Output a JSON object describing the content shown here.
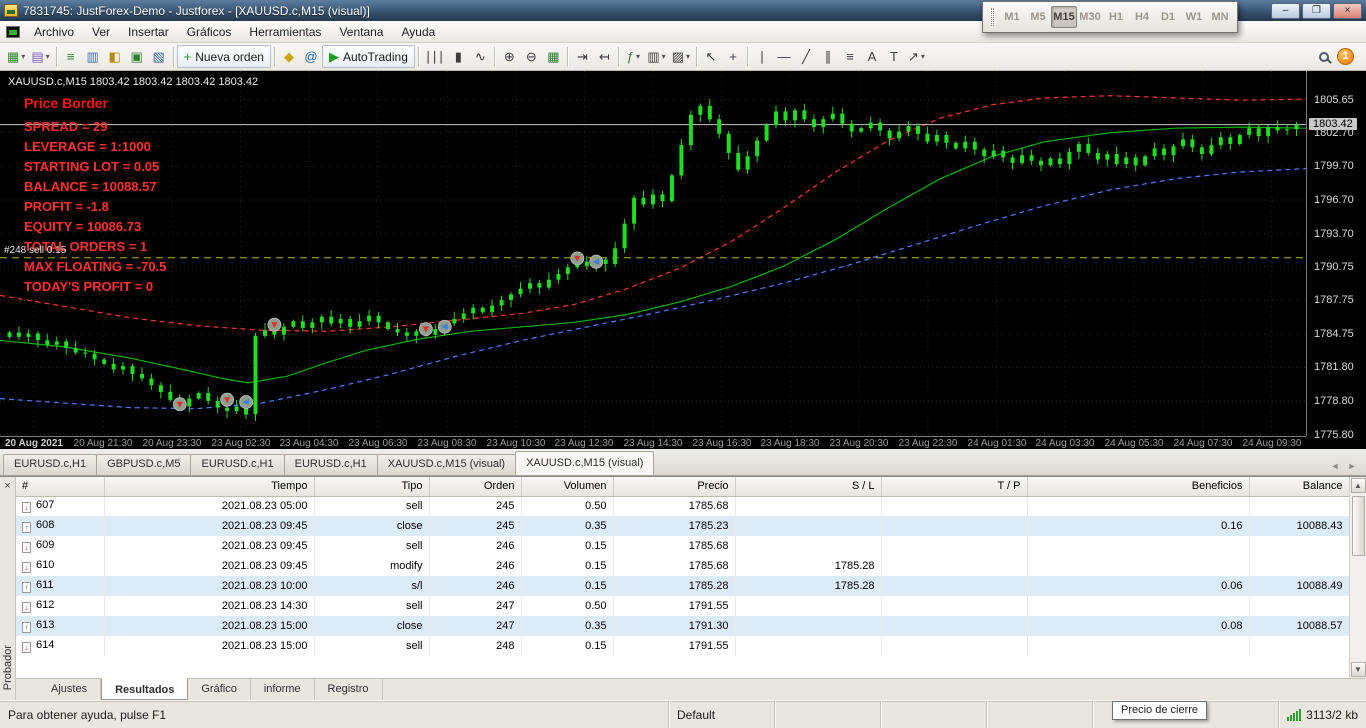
{
  "titlebar": {
    "title": "7831745: JustForex-Demo - Justforex - [XAUUSD.c,M15 (visual)]",
    "minimize": "–",
    "restore": "❐",
    "close": "×"
  },
  "menubar": {
    "items": [
      "Archivo",
      "Ver",
      "Insertar",
      "Gráficos",
      "Herramientas",
      "Ventana",
      "Ayuda"
    ]
  },
  "toolbar": {
    "buttons": [
      {
        "name": "new-chart",
        "glyph": "▦",
        "color": "#2e8b2e",
        "dropdown": true
      },
      {
        "name": "profiles",
        "glyph": "▤",
        "color": "#7a5fc0",
        "dropdown": true
      },
      {
        "type": "sep"
      },
      {
        "name": "market-watch",
        "glyph": "≡",
        "color": "#2e7d32"
      },
      {
        "name": "data-window",
        "glyph": "▥",
        "color": "#4a6fa5"
      },
      {
        "name": "navigator",
        "glyph": "◧",
        "color": "#b8860b"
      },
      {
        "name": "terminal",
        "glyph": "▣",
        "color": "#2e7d32"
      },
      {
        "name": "strategy-tester",
        "glyph": "▧",
        "color": "#4a6fa5"
      },
      {
        "type": "sep"
      },
      {
        "name": "new-order",
        "glyph": "+",
        "color": "#18a018",
        "label": "Nueva orden"
      },
      {
        "type": "sep"
      },
      {
        "name": "metaeditor",
        "glyph": "◆",
        "color": "#c9a313"
      },
      {
        "name": "mql-community",
        "glyph": "@",
        "color": "#1565c0"
      },
      {
        "name": "autotrading",
        "glyph": "▶",
        "color": "#18a018",
        "label": "AutoTrading"
      },
      {
        "type": "sep"
      },
      {
        "name": "chart-bars",
        "glyph": "∣∣∣",
        "color": "#3c3c3c"
      },
      {
        "name": "chart-candles",
        "glyph": "▮",
        "color": "#3c3c3c"
      },
      {
        "name": "chart-line",
        "glyph": "∿",
        "color": "#3c3c3c"
      },
      {
        "type": "sep"
      },
      {
        "name": "zoom-in",
        "glyph": "⊕",
        "color": "#3c3c3c"
      },
      {
        "name": "zoom-out",
        "glyph": "⊖",
        "color": "#3c3c3c"
      },
      {
        "name": "tile-windows",
        "glyph": "▦",
        "color": "#2e7d32"
      },
      {
        "type": "sep"
      },
      {
        "name": "auto-scroll",
        "glyph": "⇥",
        "color": "#3c3c3c"
      },
      {
        "name": "chart-shift",
        "glyph": "↤",
        "color": "#3c3c3c"
      },
      {
        "type": "sep"
      },
      {
        "name": "indicators",
        "glyph": "ƒ",
        "color": "#2e7d32",
        "dropdown": true
      },
      {
        "name": "periods",
        "glyph": "▥",
        "color": "#3c3c3c",
        "dropdown": true
      },
      {
        "name": "templates",
        "glyph": "▨",
        "color": "#3c3c3c",
        "dropdown": true
      },
      {
        "type": "sep"
      },
      {
        "name": "cursor",
        "glyph": "↖",
        "color": "#3c3c3c"
      },
      {
        "name": "crosshair",
        "glyph": "+",
        "color": "#3c3c3c"
      },
      {
        "type": "sep"
      },
      {
        "name": "vertical-line",
        "glyph": "∣",
        "color": "#3c3c3c"
      },
      {
        "name": "horizontal-line",
        "glyph": "―",
        "color": "#3c3c3c"
      },
      {
        "name": "trendline",
        "glyph": "╱",
        "color": "#3c3c3c"
      },
      {
        "name": "channel",
        "glyph": "∥",
        "color": "#3c3c3c"
      },
      {
        "name": "fibonacci",
        "glyph": "≡",
        "color": "#3c3c3c"
      },
      {
        "name": "text",
        "glyph": "A",
        "color": "#3c3c3c"
      },
      {
        "name": "text-label",
        "glyph": "T",
        "color": "#3c3c3c"
      },
      {
        "name": "arrows",
        "glyph": "↗",
        "color": "#3c3c3c",
        "dropdown": true
      }
    ],
    "notification_count": "1"
  },
  "tf_toolbar": {
    "buttons": [
      "M1",
      "M5",
      "M15",
      "M30",
      "H1",
      "H4",
      "D1",
      "W1",
      "MN"
    ],
    "active": "M15"
  },
  "chart": {
    "symbol_line": "XAUUSD.c,M15  1803.42 1803.42 1803.42 1803.42",
    "overlay_title": "Price Border",
    "overlay_lines": [
      "SPREAD = 29",
      "LEVERAGE = 1:1000",
      "STARTING LOT = 0.05",
      "BALANCE = 10088.57",
      "PROFIT = -1.8",
      "EQUITY = 10086.73",
      "TOTAL ORDERS = 1",
      "MAX FLOATING = -70.5",
      "TODAY'S PROFIT = 0"
    ]
  },
  "chart_data": {
    "type": "candlestick",
    "symbol": "XAUUSD.c",
    "timeframe": "M15",
    "y_ticks": [
      "1805.65",
      "1802.70",
      "1799.70",
      "1796.70",
      "1793.70",
      "1790.75",
      "1787.75",
      "1784.75",
      "1781.80",
      "1778.80",
      "1775.80"
    ],
    "current_price": "1803.42",
    "x_labels": [
      "20 Aug 2021",
      "20 Aug 21:30",
      "20 Aug 23:30",
      "23 Aug 02:30",
      "23 Aug 04:30",
      "23 Aug 06:30",
      "23 Aug 08:30",
      "23 Aug 10:30",
      "23 Aug 12:30",
      "23 Aug 14:30",
      "23 Aug 16:30",
      "23 Aug 18:30",
      "23 Aug 20:30",
      "23 Aug 22:30",
      "24 Aug 01:30",
      "24 Aug 03:30",
      "24 Aug 05:30",
      "24 Aug 07:30",
      "24 Aug 09:30"
    ],
    "closes": [
      1784.9,
      1784.5,
      1784.8,
      1784.2,
      1783.8,
      1784.1,
      1783.5,
      1783.1,
      1783.0,
      1782.5,
      1782.1,
      1781.6,
      1781.9,
      1781.2,
      1780.8,
      1780.2,
      1779.6,
      1778.9,
      1778.3,
      1779.0,
      1779.5,
      1778.8,
      1778.2,
      1777.9,
      1778.3,
      1777.6,
      1784.6,
      1785.1,
      1784.7,
      1785.4,
      1785.9,
      1785.3,
      1785.8,
      1786.3,
      1785.7,
      1786.1,
      1785.4,
      1785.9,
      1786.4,
      1785.8,
      1785.2,
      1784.9,
      1784.6,
      1785.0,
      1784.7,
      1785.2,
      1785.7,
      1786.1,
      1786.6,
      1787.1,
      1786.7,
      1787.3,
      1787.8,
      1788.3,
      1788.8,
      1789.3,
      1788.9,
      1789.6,
      1790.1,
      1790.7,
      1791.2,
      1790.8,
      1791.4,
      1791.0,
      1792.4,
      1794.6,
      1796.9,
      1796.3,
      1797.2,
      1796.6,
      1798.9,
      1801.6,
      1804.3,
      1805.1,
      1803.9,
      1802.6,
      1800.9,
      1799.4,
      1800.6,
      1802.0,
      1803.4,
      1804.6,
      1803.8,
      1804.7,
      1803.9,
      1803.2,
      1803.9,
      1804.4,
      1803.5,
      1802.8,
      1803.1,
      1803.6,
      1802.9,
      1802.2,
      1802.8,
      1803.3,
      1802.6,
      1801.9,
      1802.5,
      1801.8,
      1801.3,
      1801.9,
      1801.2,
      1800.6,
      1801.1,
      1800.5,
      1800.0,
      1800.7,
      1800.2,
      1799.8,
      1800.4,
      1799.9,
      1801.0,
      1801.7,
      1800.9,
      1800.3,
      1800.8,
      1799.9,
      1800.5,
      1799.8,
      1800.6,
      1801.3,
      1800.7,
      1801.5,
      1802.1,
      1801.4,
      1800.8,
      1801.6,
      1802.3,
      1801.7,
      1802.5,
      1803.1,
      1802.4,
      1803.2,
      1802.9,
      1803.0,
      1803.42
    ],
    "ma_green": [
      [
        0,
        1784.2
      ],
      [
        0.05,
        1783.6
      ],
      [
        0.1,
        1782.6
      ],
      [
        0.14,
        1781.6
      ],
      [
        0.17,
        1780.8
      ],
      [
        0.19,
        1780.4
      ],
      [
        0.22,
        1781.0
      ],
      [
        0.25,
        1782.2
      ],
      [
        0.28,
        1783.3
      ],
      [
        0.32,
        1784.3
      ],
      [
        0.36,
        1785.0
      ],
      [
        0.4,
        1785.4
      ],
      [
        0.44,
        1785.8
      ],
      [
        0.48,
        1786.5
      ],
      [
        0.52,
        1787.6
      ],
      [
        0.56,
        1789.0
      ],
      [
        0.6,
        1790.8
      ],
      [
        0.64,
        1793.2
      ],
      [
        0.68,
        1796.0
      ],
      [
        0.72,
        1798.6
      ],
      [
        0.76,
        1800.6
      ],
      [
        0.8,
        1801.9
      ],
      [
        0.85,
        1802.7
      ],
      [
        0.9,
        1803.1
      ],
      [
        0.95,
        1803.2
      ],
      [
        1,
        1803.1
      ]
    ],
    "ma_red_dashed": [
      [
        0,
        1788.2
      ],
      [
        0.05,
        1787.2
      ],
      [
        0.1,
        1786.2
      ],
      [
        0.15,
        1785.5
      ],
      [
        0.2,
        1785.1
      ],
      [
        0.25,
        1785.0
      ],
      [
        0.3,
        1785.4
      ],
      [
        0.35,
        1786.0
      ],
      [
        0.4,
        1786.6
      ],
      [
        0.44,
        1787.4
      ],
      [
        0.48,
        1788.8
      ],
      [
        0.52,
        1790.6
      ],
      [
        0.56,
        1793.0
      ],
      [
        0.6,
        1796.0
      ],
      [
        0.64,
        1799.2
      ],
      [
        0.68,
        1802.0
      ],
      [
        0.72,
        1804.0
      ],
      [
        0.76,
        1805.2
      ],
      [
        0.8,
        1805.8
      ],
      [
        0.85,
        1806.0
      ],
      [
        0.9,
        1805.8
      ],
      [
        0.95,
        1805.6
      ],
      [
        1,
        1805.7
      ]
    ],
    "ma_blue_dashed": [
      [
        0,
        1779.0
      ],
      [
        0.05,
        1778.6
      ],
      [
        0.1,
        1778.2
      ],
      [
        0.15,
        1778.1
      ],
      [
        0.2,
        1778.6
      ],
      [
        0.25,
        1779.8
      ],
      [
        0.3,
        1781.2
      ],
      [
        0.35,
        1782.8
      ],
      [
        0.4,
        1784.2
      ],
      [
        0.45,
        1785.4
      ],
      [
        0.5,
        1786.6
      ],
      [
        0.55,
        1787.9
      ],
      [
        0.6,
        1789.3
      ],
      [
        0.65,
        1790.9
      ],
      [
        0.7,
        1792.7
      ],
      [
        0.75,
        1794.5
      ],
      [
        0.8,
        1796.2
      ],
      [
        0.85,
        1797.6
      ],
      [
        0.9,
        1798.6
      ],
      [
        0.95,
        1799.2
      ],
      [
        1,
        1799.5
      ]
    ],
    "order_line": {
      "price": 1791.55,
      "label": "#248 sell 0.15",
      "color": "#b5b500"
    },
    "bid_line": {
      "price": 1803.42,
      "color": "#c8c8c8"
    },
    "markers": [
      {
        "i": 18,
        "p": 1778.5,
        "k": "sell"
      },
      {
        "i": 23,
        "p": 1778.9,
        "k": "sell"
      },
      {
        "i": 25,
        "p": 1778.7,
        "k": "close"
      },
      {
        "i": 28,
        "p": 1785.6,
        "k": "sell"
      },
      {
        "i": 44,
        "p": 1785.2,
        "k": "sell"
      },
      {
        "i": 46,
        "p": 1785.4,
        "k": "close"
      },
      {
        "i": 60,
        "p": 1791.5,
        "k": "sell"
      },
      {
        "i": 62,
        "p": 1791.2,
        "k": "close"
      }
    ],
    "colors": {
      "candle": "#1fdd1f",
      "ma_green": "#00b400",
      "red_dashed": "#ff3333",
      "blue_dashed": "#4f7bff",
      "overlay_text": "#ff3030",
      "background": "#000000"
    }
  },
  "chart_tabs": {
    "tabs": [
      "EURUSD.c,H1",
      "GBPUSD.c,M5",
      "EURUSD.c,H1",
      "EURUSD.c,H1",
      "XAUUSD.c,M15 (visual)",
      "XAUUSD.c,M15 (visual)"
    ],
    "active_index": 5
  },
  "tester": {
    "sidebar_label": "Probador",
    "columns": [
      "#",
      "Tiempo",
      "Tipo",
      "Orden",
      "Volumen",
      "Precio",
      "S / L",
      "T / P",
      "Beneficios",
      "Balance"
    ],
    "rows": [
      {
        "icon": "sell",
        "num": "607",
        "time": "2021.08.23 05:00",
        "type": "sell",
        "order": "245",
        "volume": "0.50",
        "price": "1785.68",
        "sl": "",
        "tp": "",
        "profit": "",
        "balance": "",
        "hl": false
      },
      {
        "icon": "close",
        "num": "608",
        "time": "2021.08.23 09:45",
        "type": "close",
        "order": "245",
        "volume": "0.35",
        "price": "1785.23",
        "sl": "",
        "tp": "",
        "profit": "0.16",
        "balance": "10088.43",
        "hl": true
      },
      {
        "icon": "sell",
        "num": "609",
        "time": "2021.08.23 09:45",
        "type": "sell",
        "order": "246",
        "volume": "0.15",
        "price": "1785.68",
        "sl": "",
        "tp": "",
        "profit": "",
        "balance": "",
        "hl": false
      },
      {
        "icon": "sell",
        "num": "610",
        "time": "2021.08.23 09:45",
        "type": "modify",
        "order": "246",
        "volume": "0.15",
        "price": "1785.68",
        "sl": "1785.28",
        "tp": "",
        "profit": "",
        "balance": "",
        "hl": false
      },
      {
        "icon": "close",
        "num": "611",
        "time": "2021.08.23 10:00",
        "type": "s/l",
        "order": "246",
        "volume": "0.15",
        "price": "1785.28",
        "sl": "1785.28",
        "tp": "",
        "profit": "0.06",
        "balance": "10088.49",
        "hl": true
      },
      {
        "icon": "sell",
        "num": "612",
        "time": "2021.08.23 14:30",
        "type": "sell",
        "order": "247",
        "volume": "0.50",
        "price": "1791.55",
        "sl": "",
        "tp": "",
        "profit": "",
        "balance": "",
        "hl": false
      },
      {
        "icon": "close",
        "num": "613",
        "time": "2021.08.23 15:00",
        "type": "close",
        "order": "247",
        "volume": "0.35",
        "price": "1791.30",
        "sl": "",
        "tp": "",
        "profit": "0.08",
        "balance": "10088.57",
        "hl": true
      },
      {
        "icon": "sell",
        "num": "614",
        "time": "2021.08.23 15:00",
        "type": "sell",
        "order": "248",
        "volume": "0.15",
        "price": "1791.55",
        "sl": "",
        "tp": "",
        "profit": "",
        "balance": "",
        "hl": false
      }
    ],
    "tabs": [
      "Ajustes",
      "Resultados",
      "Gráfico",
      "informe",
      "Registro"
    ],
    "active_tab": "Resultados"
  },
  "statusbar": {
    "help_text": "Para obtener ayuda, pulse F1",
    "profile": "Default",
    "tooltip": "Precio de cierre",
    "connection": "3113/2 kb"
  }
}
